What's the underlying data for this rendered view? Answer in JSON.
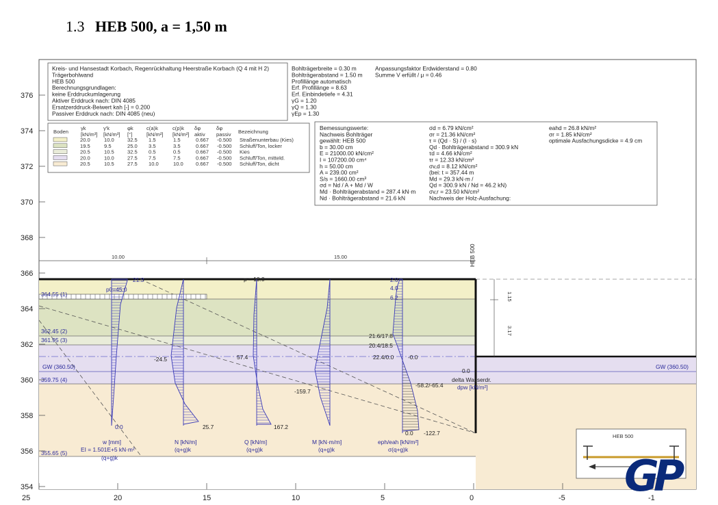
{
  "heading": {
    "number": "1.3",
    "title": "HEB 500, a =  1,50 m"
  },
  "y_axis": {
    "labels": [
      "376",
      "374",
      "372",
      "370",
      "368",
      "366",
      "364",
      "362",
      "360",
      "358",
      "356",
      "354"
    ]
  },
  "x_axis": {
    "labels": [
      "25",
      "20",
      "15",
      "10",
      "5",
      "0",
      "-5",
      "-1"
    ]
  },
  "info_left": [
    "Kreis- und Hansestadt Korbach, Regenrückhaltung Heerstraße Korbach (Q 4 mit H 2)",
    "Trägerbohlwand",
    "HEB 500",
    "Berechnungsgrundlagen:",
    "keine Erddruckumlagerung",
    "Aktiver Erddruck nach: DIN 4085",
    "Ersatzerddruck-Beiwert kah [-] = 0.200",
    "Passiver Erddruck nach: DIN 4085 (neu)"
  ],
  "info_mid": [
    "Bohlträgerbreite = 0.30 m",
    "Bohlträgerabstand = 1.50 m",
    "Profillänge automatisch",
    "Erf. Profillänge = 8.63",
    "Erf. Einbindetiefe = 4.31",
    "γG = 1.20",
    "γQ = 1.30",
    "γEp = 1.30"
  ],
  "info_right": [
    "Anpassungsfaktor Erdwiderstand = 0.80",
    "Summe V erfüllt / μ = 0.46"
  ],
  "soil_table": {
    "headers": [
      "Boden",
      "γk [kN/m³]",
      "γ'k [kN/m³]",
      "φk [°]",
      "c(a)k [kN/m²]",
      "c(p)k [kN/m²]",
      "δφ aktiv",
      "δφ passiv",
      "Bezeichnung"
    ],
    "rows": [
      {
        "color": "#f3f0c8",
        "cells": [
          "20.0",
          "10.0",
          "32.5",
          "1.5",
          "1.5",
          "0.667",
          "-0.500",
          "Straßenunterbau (Kies)"
        ]
      },
      {
        "color": "#dde3c2",
        "cells": [
          "19.5",
          "9.5",
          "25.0",
          "3.5",
          "3.5",
          "0.667",
          "-0.500",
          "Schluff/Ton, locker"
        ]
      },
      {
        "color": "#e9ecd9",
        "cells": [
          "20.5",
          "10.5",
          "32.5",
          "0.5",
          "0.5",
          "0.667",
          "-0.500",
          "Kies"
        ]
      },
      {
        "color": "#e5def0",
        "cells": [
          "20.0",
          "10.0",
          "27.5",
          "7.5",
          "7.5",
          "0.667",
          "-0.500",
          "Schluff/Ton, mitteld."
        ]
      },
      {
        "color": "#f8ebd3",
        "cells": [
          "20.5",
          "10.5",
          "27.5",
          "10.0",
          "10.0",
          "0.667",
          "-0.500",
          "Schluff/Ton, dicht"
        ]
      }
    ]
  },
  "design_values": {
    "col1": [
      "Bemessungswerte:",
      "Nachweis Bohlträger",
      "gewählt: HEB 500",
      "b = 30.00 cm",
      "E = 21000.00 kN/cm²",
      "I = 107200.00 cm⁴",
      "h = 50.00 cm",
      "A = 239.00 cm²",
      "S/s = 1660.00 cm³",
      "σd = Nd / A + Md / W",
      "Md · Bohlträgerabstand = 287.4 kN·m",
      "Nd · Bohlträgerabstand = 21.6 kN"
    ],
    "col2": [
      "σd = 6.79 kN/cm²",
      "σr = 21.36 kN/cm²",
      "τ = (Qd · S) / (I · s)",
      "Qd · Bohlträgerabstand = 300.9 kN",
      "τd = 4.66 kN/cm²",
      "τr = 12.33 kN/cm²",
      "σv,d = 8.12 kN/cm²",
      "(bei: t = 357.44 m",
      "Md = 29.3 kN·m /",
      "Qd = 300.9 kN / Nd = 46.2 kN)",
      "σv,r = 23.50 kN/cm²",
      "Nachweis der Holz-Ausfachung:"
    ],
    "col3": [
      "eahd = 26.8 kN/m²",
      "σr = 1.85 kN/cm²",
      "optimale Ausfachungsdicke = 4.9 cm"
    ]
  },
  "layers": [
    {
      "label": "364.55 (1)"
    },
    {
      "label": "362.45 (2)"
    },
    {
      "label": "361.95 (3)"
    },
    {
      "label": "359.75 (4)"
    },
    {
      "label": "355.65 (5)"
    }
  ],
  "gw": {
    "left": "GW (360.50)",
    "right": "GW (360.50)"
  },
  "dims": {
    "d1": "10.00",
    "d2": "15.00",
    "d3": "1.15",
    "d4": "3.17"
  },
  "wall": {
    "label": "HEB 500"
  },
  "loads": {
    "p0": "p0=45.0",
    "p": "p = 10.0"
  },
  "diagram_values": {
    "w_top": "21.3",
    "w_bot": "0.0",
    "n_mid": "-24.5",
    "n_bot": "25.7",
    "q_mid": "57.4",
    "q_bot": "167.2",
    "m_bot": "-159.7",
    "e1": "2.0",
    "e2": "4.0",
    "e3": "6.2",
    "e4": "21.6/17.8",
    "e5": "20.4/18.5",
    "e6": "22.4/0.0",
    "e7": "-0.0",
    "e8": "-58.2/-65.4",
    "e9": "0.0",
    "e10": "-122.7",
    "zero": "0.0"
  },
  "captions": {
    "w": "w [mm]",
    "ei": "EI = 1.501E+5 kN·m²",
    "w_sub": "(q+g)k",
    "n": "N [kN/m]",
    "n_sub": "(q+g)k",
    "q": "Q [kN/m]",
    "q_sub": "(q+g)k",
    "m": "M [kN·m/m]",
    "m_sub": "(q+g)k",
    "e": "eph/eah [kN/m²]",
    "e_sub": "σ(q+g)k",
    "delta": "delta Wasserdr.",
    "dpw": "dpw [kN/m²]"
  },
  "inset": {
    "label": "HEB 500"
  },
  "logo": {
    "text": "GP",
    "color": "#0a2a7a"
  }
}
